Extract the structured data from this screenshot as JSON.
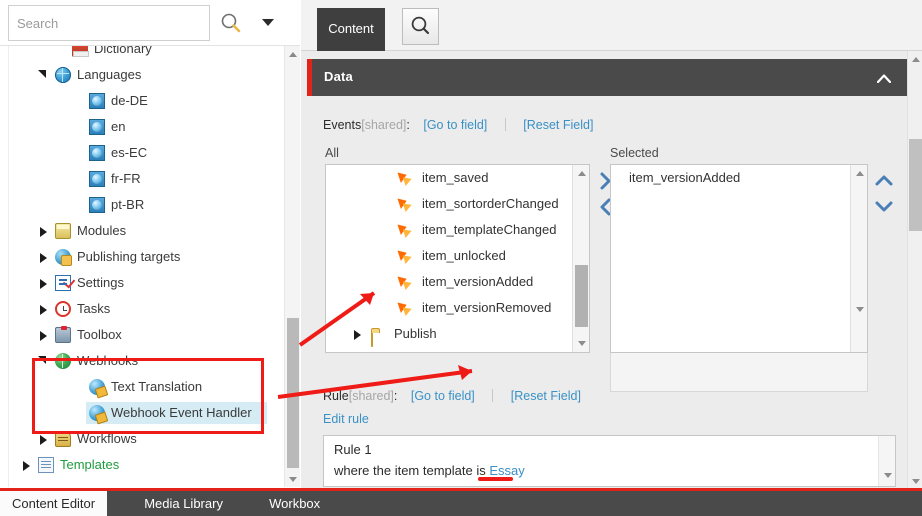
{
  "search": {
    "placeholder": "Search",
    "value": "",
    "icon": "search-icon",
    "dropdown_icon": "chevron-down-icon"
  },
  "tree": {
    "nodes": [
      {
        "label": "Dictionary",
        "indent": 3,
        "icon": "book-icon",
        "state": "leaf",
        "selected": false,
        "green": false
      },
      {
        "label": "Languages",
        "indent": 2,
        "icon": "globe-icon",
        "state": "expanded",
        "selected": false,
        "green": false
      },
      {
        "label": "de-DE",
        "indent": 4,
        "icon": "language-icon",
        "state": "leaf",
        "selected": false,
        "green": false
      },
      {
        "label": "en",
        "indent": 4,
        "icon": "language-icon",
        "state": "leaf",
        "selected": false,
        "green": false
      },
      {
        "label": "es-EC",
        "indent": 4,
        "icon": "language-icon",
        "state": "leaf",
        "selected": false,
        "green": false
      },
      {
        "label": "fr-FR",
        "indent": 4,
        "icon": "language-icon",
        "state": "leaf",
        "selected": false,
        "green": false
      },
      {
        "label": "pt-BR",
        "indent": 4,
        "icon": "language-icon",
        "state": "leaf",
        "selected": false,
        "green": false
      },
      {
        "label": "Modules",
        "indent": 2,
        "icon": "module-icon",
        "state": "collapsed",
        "selected": false,
        "green": false
      },
      {
        "label": "Publishing targets",
        "indent": 2,
        "icon": "publish-icon",
        "state": "collapsed",
        "selected": false,
        "green": false
      },
      {
        "label": "Settings",
        "indent": 2,
        "icon": "settings-icon",
        "state": "collapsed",
        "selected": false,
        "green": false
      },
      {
        "label": "Tasks",
        "indent": 2,
        "icon": "clock-icon",
        "state": "collapsed",
        "selected": false,
        "green": false
      },
      {
        "label": "Toolbox",
        "indent": 2,
        "icon": "toolbox-icon",
        "state": "collapsed",
        "selected": false,
        "green": false
      },
      {
        "label": "Webhooks",
        "indent": 2,
        "icon": "webhook-globe-icon",
        "state": "expanded",
        "selected": false,
        "green": false
      },
      {
        "label": "Text Translation",
        "indent": 4,
        "icon": "webhook-item-icon",
        "state": "leaf",
        "selected": false,
        "green": false
      },
      {
        "label": "Webhook Event Handler",
        "indent": 4,
        "icon": "webhook-item-icon",
        "state": "leaf",
        "selected": true,
        "green": false
      },
      {
        "label": "Workflows",
        "indent": 2,
        "icon": "workflow-icon",
        "state": "collapsed",
        "selected": false,
        "green": false
      },
      {
        "label": "Templates",
        "indent": 1,
        "icon": "template-icon",
        "state": "collapsed",
        "selected": false,
        "green": true
      }
    ]
  },
  "tabs": {
    "content_tab": "Content",
    "search_tab_icon": "search-icon"
  },
  "section": {
    "title": "Data",
    "collapse_icon": "chevron-up-icon",
    "accent_color": "#e2231a",
    "header_color": "#4a4a4a"
  },
  "events_field": {
    "name": "Events",
    "shared": "[shared]",
    "go_to_field": "[Go to field]",
    "reset_field": "[Reset Field]",
    "all_label": "All",
    "selected_label": "Selected",
    "all_items": [
      {
        "label": "item_saved",
        "icon": "event-bolt-icon",
        "type": "event"
      },
      {
        "label": "item_sortorderChanged",
        "icon": "event-bolt-icon",
        "type": "event"
      },
      {
        "label": "item_templateChanged",
        "icon": "event-bolt-icon",
        "type": "event"
      },
      {
        "label": "item_unlocked",
        "icon": "event-bolt-icon",
        "type": "event"
      },
      {
        "label": "item_versionAdded",
        "icon": "event-bolt-icon",
        "type": "event"
      },
      {
        "label": "item_versionRemoved",
        "icon": "event-bolt-icon",
        "type": "event"
      },
      {
        "label": "Publish",
        "icon": "folder-icon",
        "type": "folder"
      }
    ],
    "selected_items": [
      {
        "label": "item_versionAdded"
      }
    ],
    "move_right_icon": "chevron-right-icon",
    "move_left_icon": "chevron-left-icon",
    "move_up_icon": "chevron-up-icon",
    "move_down_icon": "chevron-down-icon"
  },
  "rule_field": {
    "name": "Rule",
    "shared": "[shared]",
    "go_to_field": "[Go to field]",
    "reset_field": "[Reset Field]",
    "edit_rule": "Edit rule",
    "rule_title": "Rule 1",
    "rule_condition_prefix": "where the item template is ",
    "rule_condition_link": "Essay"
  },
  "bottom_tabs": [
    {
      "label": "Content Editor",
      "active": true
    },
    {
      "label": "Media Library",
      "active": false
    },
    {
      "label": "Workbox",
      "active": false
    }
  ],
  "annotations": {
    "highlight_color": "#ef1b16",
    "box_target": "webhooks-tree-group",
    "arrow_from": "webhook-event-handler-node",
    "arrow_to": "item_versionAdded",
    "underline_target": "Essay"
  }
}
